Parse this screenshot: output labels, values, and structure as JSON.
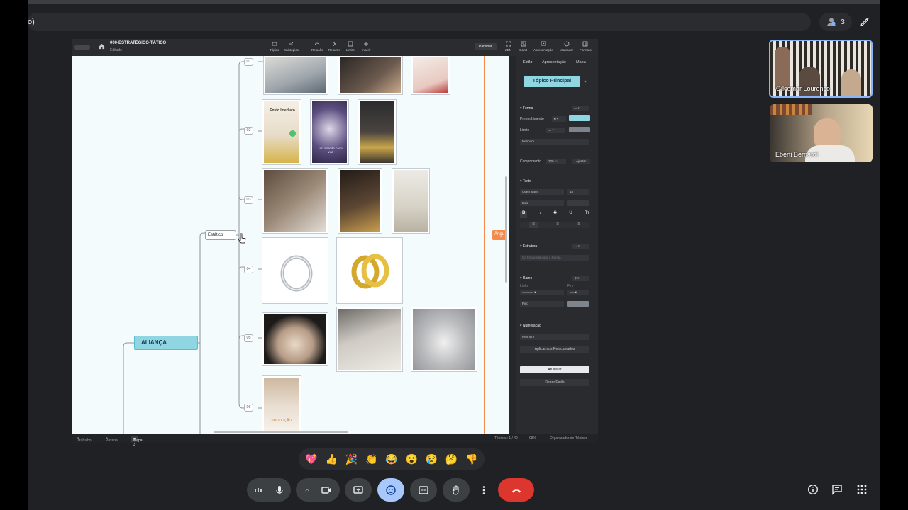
{
  "meeting": {
    "title_fragment": "o)",
    "participants_count": "3"
  },
  "app": {
    "doc_title": "000-ESTRATÉGICO-TÁTICO",
    "doc_subtitle": "Editado",
    "share_label": "Partilhar",
    "tools": [
      {
        "label": "Tópico",
        "icon": "topic-icon"
      },
      {
        "label": "Subtópico",
        "icon": "subtopic-icon"
      },
      {
        "label": "Relação",
        "icon": "relation-icon"
      },
      {
        "label": "Resumo",
        "icon": "summary-icon"
      },
      {
        "label": "Limite",
        "icon": "boundary-icon"
      },
      {
        "label": "Inserir",
        "icon": "insert-icon"
      },
      {
        "label": "ZEN",
        "icon": "zen-icon"
      },
      {
        "label": "Gantt",
        "icon": "gantt-icon"
      },
      {
        "label": "Apresentação",
        "icon": "presentation-icon"
      },
      {
        "label": "Marcador",
        "icon": "marker-icon"
      },
      {
        "label": "Formato",
        "icon": "format-icon"
      }
    ]
  },
  "mindmap": {
    "main_topic": "ALIANÇA",
    "static_topic": "Estático",
    "orange_tag": "Ângu",
    "numbers": [
      "01",
      "02",
      "03",
      "04",
      "05",
      "06"
    ],
    "thumb_texts": {
      "envio_title": "Envio Imediato",
      "phrase": "um anel de cada vez",
      "producao": "PRODUÇÃO"
    }
  },
  "status_bar": {
    "tabs": [
      "Trabalho",
      "Pessoal",
      "Mapa 3"
    ],
    "add_tab": "+",
    "topics": "Tópicos: 1 / 49",
    "zoom": "98%",
    "organizer": "Organizador de Tópicos"
  },
  "panel": {
    "tabs": [
      "Estilo",
      "Apresentação",
      "Mapa"
    ],
    "topic_style_button": "Tópico Principal",
    "shape_section": "Forma",
    "fill_label": "Preenchimento",
    "border_label": "Limite",
    "border_value": "Nenhum",
    "length_label": "Comprimento",
    "length_value": "200",
    "length_unit": "Px",
    "adjust_button": "Ajustar",
    "text_section": "Texto",
    "font_family": "Open Sans",
    "font_size": "18",
    "font_weight": "Bold",
    "structure_section": "Estrutura",
    "structure_value": "Da Esquerda para a Direita",
    "branch_section": "Ramo",
    "line_label": "Linha",
    "end_label": "Fim",
    "branch_width": "Fino",
    "numbering_section": "Numeração",
    "numbering_value": "Nenhum",
    "apply_related": "Aplicar aos Relacionados",
    "update_button": "Atualizar",
    "reset_style": "Repor Estilo",
    "fill_color": "#8fd6e2"
  },
  "participants": [
    {
      "name": "Gilcemar Lourenço"
    },
    {
      "name": "Eberti Bernardi"
    }
  ],
  "reactions": [
    "💖",
    "👍",
    "🎉",
    "👏",
    "😂",
    "😮",
    "😢",
    "🤔",
    "👎"
  ]
}
